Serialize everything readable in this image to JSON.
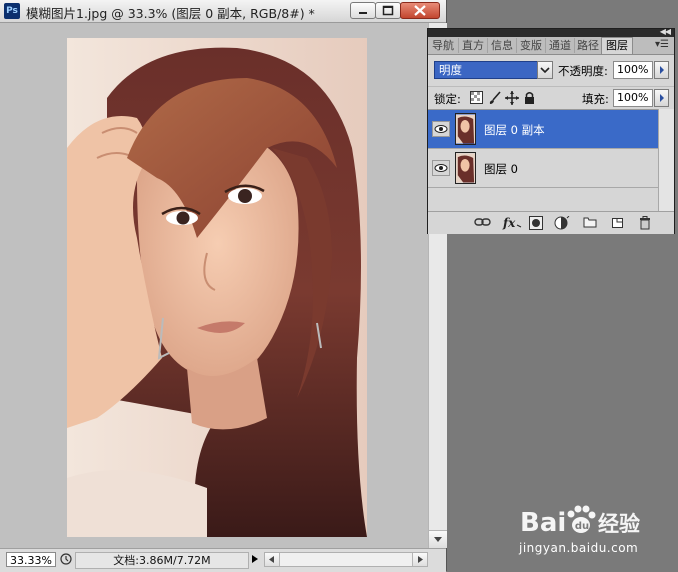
{
  "window": {
    "title": "模糊图片1.jpg @ 33.3% (图层 0 副本, RGB/8#) *",
    "app_icon": "Ps"
  },
  "status": {
    "zoom": "33.33%",
    "doc_info": "文档:3.86M/7.72M"
  },
  "panel": {
    "tabs": [
      "导航",
      "直方",
      "信息",
      "变版",
      "通道",
      "路径",
      "图层"
    ],
    "active_tab": "图层",
    "blend_mode": "明度",
    "opacity_label": "不透明度:",
    "opacity_value": "100%",
    "lock_label": "锁定:",
    "fill_label": "填充:",
    "fill_value": "100%",
    "layers": [
      {
        "name": "图层 0 副本",
        "selected": true,
        "visible": true
      },
      {
        "name": "图层 0",
        "selected": false,
        "visible": true
      }
    ]
  },
  "watermark": {
    "brand": "Bai",
    "brand_suffix": "经验",
    "url": "jingyan.baidu.com"
  },
  "colors": {
    "selection": "#3a6ac8",
    "panel_bg": "#d6d6d6",
    "canvas_bg": "#c0c0c0",
    "workspace": "#7a7a7a"
  },
  "icons": [
    "photoshop-logo",
    "minimize-icon",
    "maximize-icon",
    "close-icon",
    "navigator-icon",
    "eye-icon",
    "lock-transparent-icon",
    "lock-brush-icon",
    "lock-move-icon",
    "lock-all-icon",
    "link-icon",
    "fx-icon",
    "mask-icon",
    "adjustment-icon",
    "group-folder-icon",
    "new-layer-icon",
    "trash-icon"
  ]
}
